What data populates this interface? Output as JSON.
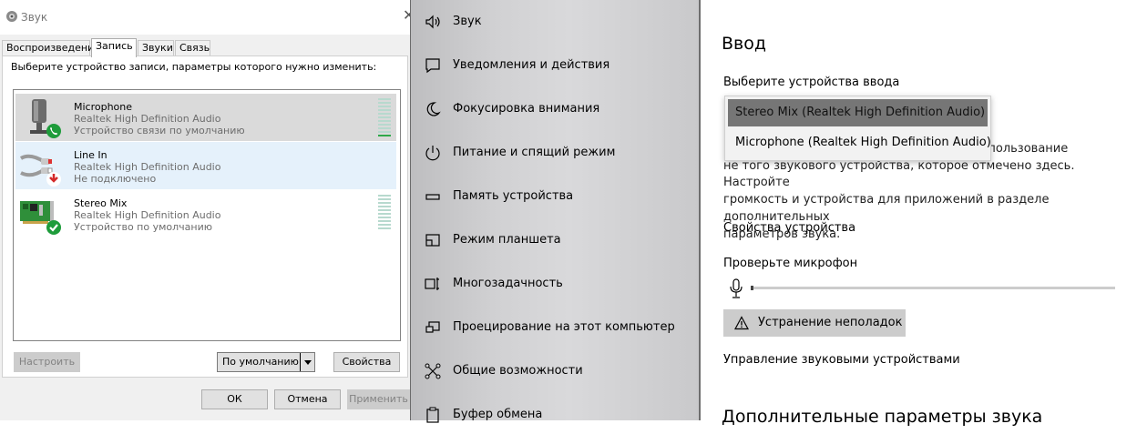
{
  "dialog": {
    "title": "Звук",
    "close_glyph": "✕",
    "tabs": [
      "Воспроизведение",
      "Запись",
      "Звуки",
      "Связь"
    ],
    "active_tab": "Запись",
    "instruction": "Выберите устройство записи, параметры которого нужно изменить:",
    "devices": [
      {
        "name": "Microphone",
        "driver": "Realtek High Definition Audio",
        "status": "Устройство связи по умолчанию",
        "icon": "microphone-icon",
        "badge": "phone-badge-icon",
        "level": 0.1
      },
      {
        "name": "Line In",
        "driver": "Realtek High Definition Audio",
        "status": "Не подключено",
        "icon": "line-in-jack-icon",
        "badge": "unplugged-badge-icon"
      },
      {
        "name": "Stereo Mix",
        "driver": "Realtek High Definition Audio",
        "status": "Устройство по умолчанию",
        "icon": "sound-card-icon",
        "badge": "checkmark-badge-icon",
        "level": 0
      }
    ],
    "buttons": {
      "configure": "Настроить",
      "set_default": "По умолчанию",
      "properties": "Свойства",
      "ok": "ОК",
      "cancel": "Отмена",
      "apply": "Применить"
    }
  },
  "nav": {
    "items": [
      {
        "label": "Звук",
        "icon": "speaker-icon"
      },
      {
        "label": "Уведомления и действия",
        "icon": "notification-icon"
      },
      {
        "label": "Фокусировка внимания",
        "icon": "moon-icon"
      },
      {
        "label": "Питание и спящий режим",
        "icon": "power-icon"
      },
      {
        "label": "Память устройства",
        "icon": "storage-icon"
      },
      {
        "label": "Режим планшета",
        "icon": "tablet-mode-icon"
      },
      {
        "label": "Многозадачность",
        "icon": "multitasking-icon"
      },
      {
        "label": "Проецирование на этот компьютер",
        "icon": "projecting-icon"
      },
      {
        "label": "Общие возможности",
        "icon": "shared-experiences-icon"
      },
      {
        "label": "Буфер обмена",
        "icon": "clipboard-icon"
      }
    ]
  },
  "content": {
    "section_title": "Ввод",
    "choose_input_label": "Выберите устройства ввода",
    "input_options": [
      "Stereo Mix (Realtek High Definition Audio)",
      "Microphone (Realtek High Definition Audio)"
    ],
    "selected_input": "Stereo Mix (Realtek High Definition Audio)",
    "info_lines": [
      "роено использование",
      "не того звукового устройства, которое отмечено здесь. Настройте",
      "громкость и устройства для приложений в разделе дополнительных",
      "параметров звука."
    ],
    "device_properties_link": "Свойства устройства",
    "test_mic_label": "Проверьте микрофон",
    "mic_level": 0,
    "troubleshoot_button": "Устранение неполадок",
    "manage_devices_link": "Управление звуковыми устройствами",
    "advanced_heading": "Дополнительные параметры звука"
  },
  "colors": {
    "selected_row": "#dadada",
    "hover_row": "#e5f1fb",
    "meter_green": "#2ea84a",
    "meter_idle": "#b7d9ce",
    "badge_green": "#1e9c3b",
    "badge_red": "#d42a2a",
    "dropdown_selected": "#767676"
  }
}
